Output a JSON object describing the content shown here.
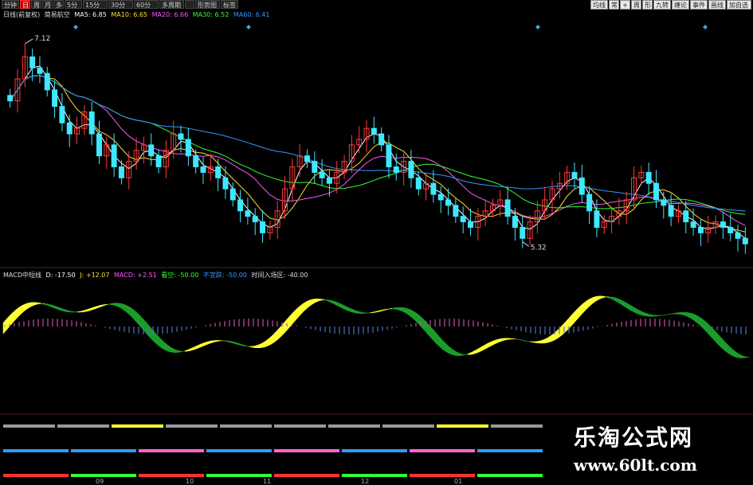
{
  "toolbar": {
    "left_buttons": [
      "分钟",
      "日",
      "周",
      "月",
      "多",
      "5分",
      "15分",
      "30分",
      "60分",
      "多周期",
      "",
      "形势图",
      "标签"
    ],
    "active_index": 1,
    "right_buttons": [
      "均线",
      "常",
      "+",
      "周",
      "形",
      "九转",
      "缠论",
      "事件",
      "画线",
      "加自选"
    ]
  },
  "price_legend": {
    "title": "日线(前复权)",
    "indicator": "简易航空",
    "ma5": "MA5: 6.85",
    "ma10": "MA10: 6.65",
    "ma20": "MA20: 6.66",
    "ma30": "MA30: 6.52",
    "ma60": "MA60: 6.41"
  },
  "macd_legend": {
    "name": "MACD中短线",
    "d": "D: -17.50",
    "j": "J: +12.07",
    "macd": "MACD: +2.51",
    "k1": "看空: -50.00",
    "k2": "不宜跌: -50.00",
    "k3": "时间入场区: -40.00"
  },
  "price_annotations": {
    "high": "7.12",
    "low": "5.32"
  },
  "x_tick_labels": [
    "09",
    "10",
    "11",
    "12",
    "01"
  ],
  "watermark": {
    "title": "乐淘公式网",
    "url": "www.60lt.com"
  },
  "colors": {
    "up": "#ff3b3b",
    "down": "#3ee8ff",
    "ma5": "#ffffff",
    "ma10": "#ffdd33",
    "ma20": "#ff55ff",
    "ma30": "#33ff33",
    "ma60": "#3399ff",
    "band_bull": "#ffff33",
    "band_bear": "#1a9e2a"
  },
  "chart_data": {
    "type": "candlestick",
    "title": "日线(前复权)",
    "price_range": [
      5.2,
      7.3
    ],
    "annotated_high": 7.12,
    "annotated_low": 5.32,
    "closes": [
      6.6,
      6.8,
      7.0,
      6.9,
      6.85,
      6.7,
      6.55,
      6.4,
      6.3,
      6.35,
      6.5,
      6.3,
      6.1,
      6.2,
      6.0,
      5.9,
      6.05,
      6.15,
      6.2,
      6.1,
      6.0,
      6.15,
      6.3,
      6.25,
      6.1,
      6.0,
      5.95,
      6.0,
      5.9,
      5.8,
      5.7,
      5.6,
      5.55,
      5.5,
      5.4,
      5.45,
      5.6,
      5.8,
      6.0,
      6.1,
      6.05,
      5.95,
      5.9,
      5.85,
      5.95,
      6.05,
      6.2,
      6.25,
      6.35,
      6.3,
      6.2,
      6.0,
      5.95,
      6.05,
      5.9,
      5.8,
      5.85,
      5.75,
      5.7,
      5.65,
      5.55,
      5.5,
      5.45,
      5.55,
      5.6,
      5.65,
      5.7,
      5.55,
      5.45,
      5.35,
      5.5,
      5.6,
      5.7,
      5.8,
      5.85,
      5.95,
      5.9,
      5.75,
      5.6,
      5.45,
      5.5,
      5.55,
      5.6,
      5.7,
      5.9,
      5.95,
      5.85,
      5.7,
      5.65,
      5.55,
      5.6,
      5.5,
      5.45,
      5.4,
      5.45,
      5.5,
      5.45,
      5.4,
      5.35,
      5.3
    ]
  }
}
